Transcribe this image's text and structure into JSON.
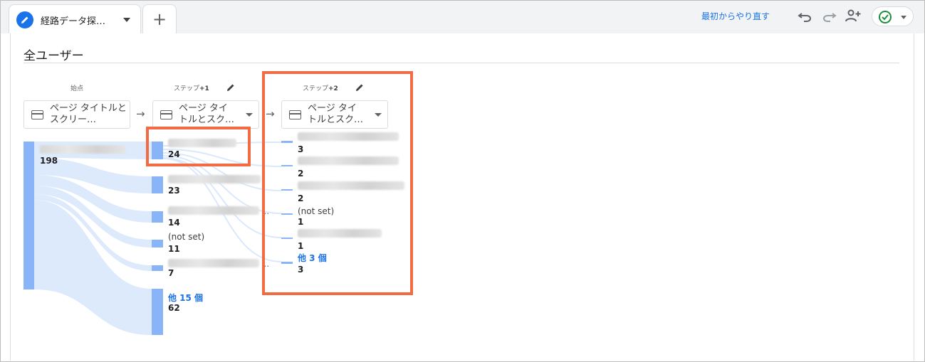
{
  "tab": {
    "title": "経路データ探…",
    "add_label": "+"
  },
  "toolbar": {
    "reset_label": "最初からやり直す"
  },
  "segment": {
    "title": "全ユーザー"
  },
  "columns": [
    {
      "header": "始点",
      "step_suffix": "",
      "dimension": "ページ タイトルとスクリー…"
    },
    {
      "header": "ステップ",
      "step_suffix": "+1",
      "dimension_line1": "ページ タイ",
      "dimension_line2": "トルとスク…"
    },
    {
      "header": "ステップ",
      "step_suffix": "+2",
      "dimension_line1": "ページ タイ",
      "dimension_line2": "トルとスク…"
    }
  ],
  "start": {
    "value": "198"
  },
  "step1": [
    {
      "label": "",
      "value": "24"
    },
    {
      "label": "",
      "value": "23"
    },
    {
      "label": "",
      "value": "14"
    },
    {
      "label": "(not set)",
      "value": "11"
    },
    {
      "label": "",
      "value": "7"
    },
    {
      "label": "他 15 個",
      "value": "62"
    }
  ],
  "step2": [
    {
      "label": "",
      "value": "3"
    },
    {
      "label": "",
      "value": "2"
    },
    {
      "label": "",
      "value": "2"
    },
    {
      "label": "(not set)",
      "value": "1"
    },
    {
      "label": "",
      "value": "1"
    },
    {
      "label": "他 3 個",
      "value": "3"
    }
  ],
  "ellipsis": "…",
  "colors": {
    "accent": "#1a73e8",
    "node": "#8ab4f8",
    "flow": "#d2e3fc",
    "highlight": "#f26b43"
  },
  "icons": [
    "pencil-icon",
    "plus-icon",
    "undo-icon",
    "redo-icon",
    "add-person-icon",
    "check-circle-icon",
    "table-icon",
    "chevron-down-icon",
    "arrow-right-icon",
    "edit-icon"
  ]
}
